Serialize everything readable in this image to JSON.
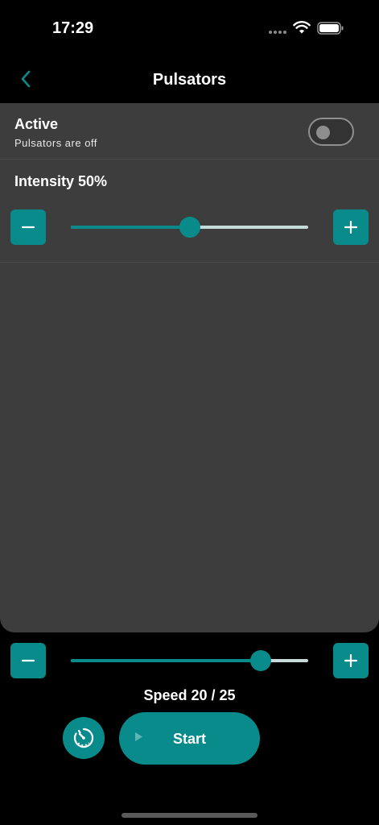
{
  "status_bar": {
    "time": "17:29"
  },
  "nav": {
    "title": "Pulsators",
    "back_icon": "chevron-left-icon"
  },
  "active": {
    "label": "Active",
    "sublabel": "Pulsators are off",
    "toggle_on": false
  },
  "intensity": {
    "label": "Intensity 50%",
    "value_percent": 50,
    "decrease_icon": "minus-icon",
    "increase_icon": "plus-icon"
  },
  "speed": {
    "label": "Speed 20 / 25",
    "value": 20,
    "max": 25,
    "decrease_icon": "minus-icon",
    "increase_icon": "plus-icon"
  },
  "actions": {
    "timer_icon": "speed-timer-icon",
    "start_label": "Start",
    "start_icon": "play-icon"
  },
  "colors": {
    "accent": "#0a8b8b",
    "panel": "#3d3d3d",
    "background": "#000000",
    "track_inactive": "#c6dada"
  }
}
